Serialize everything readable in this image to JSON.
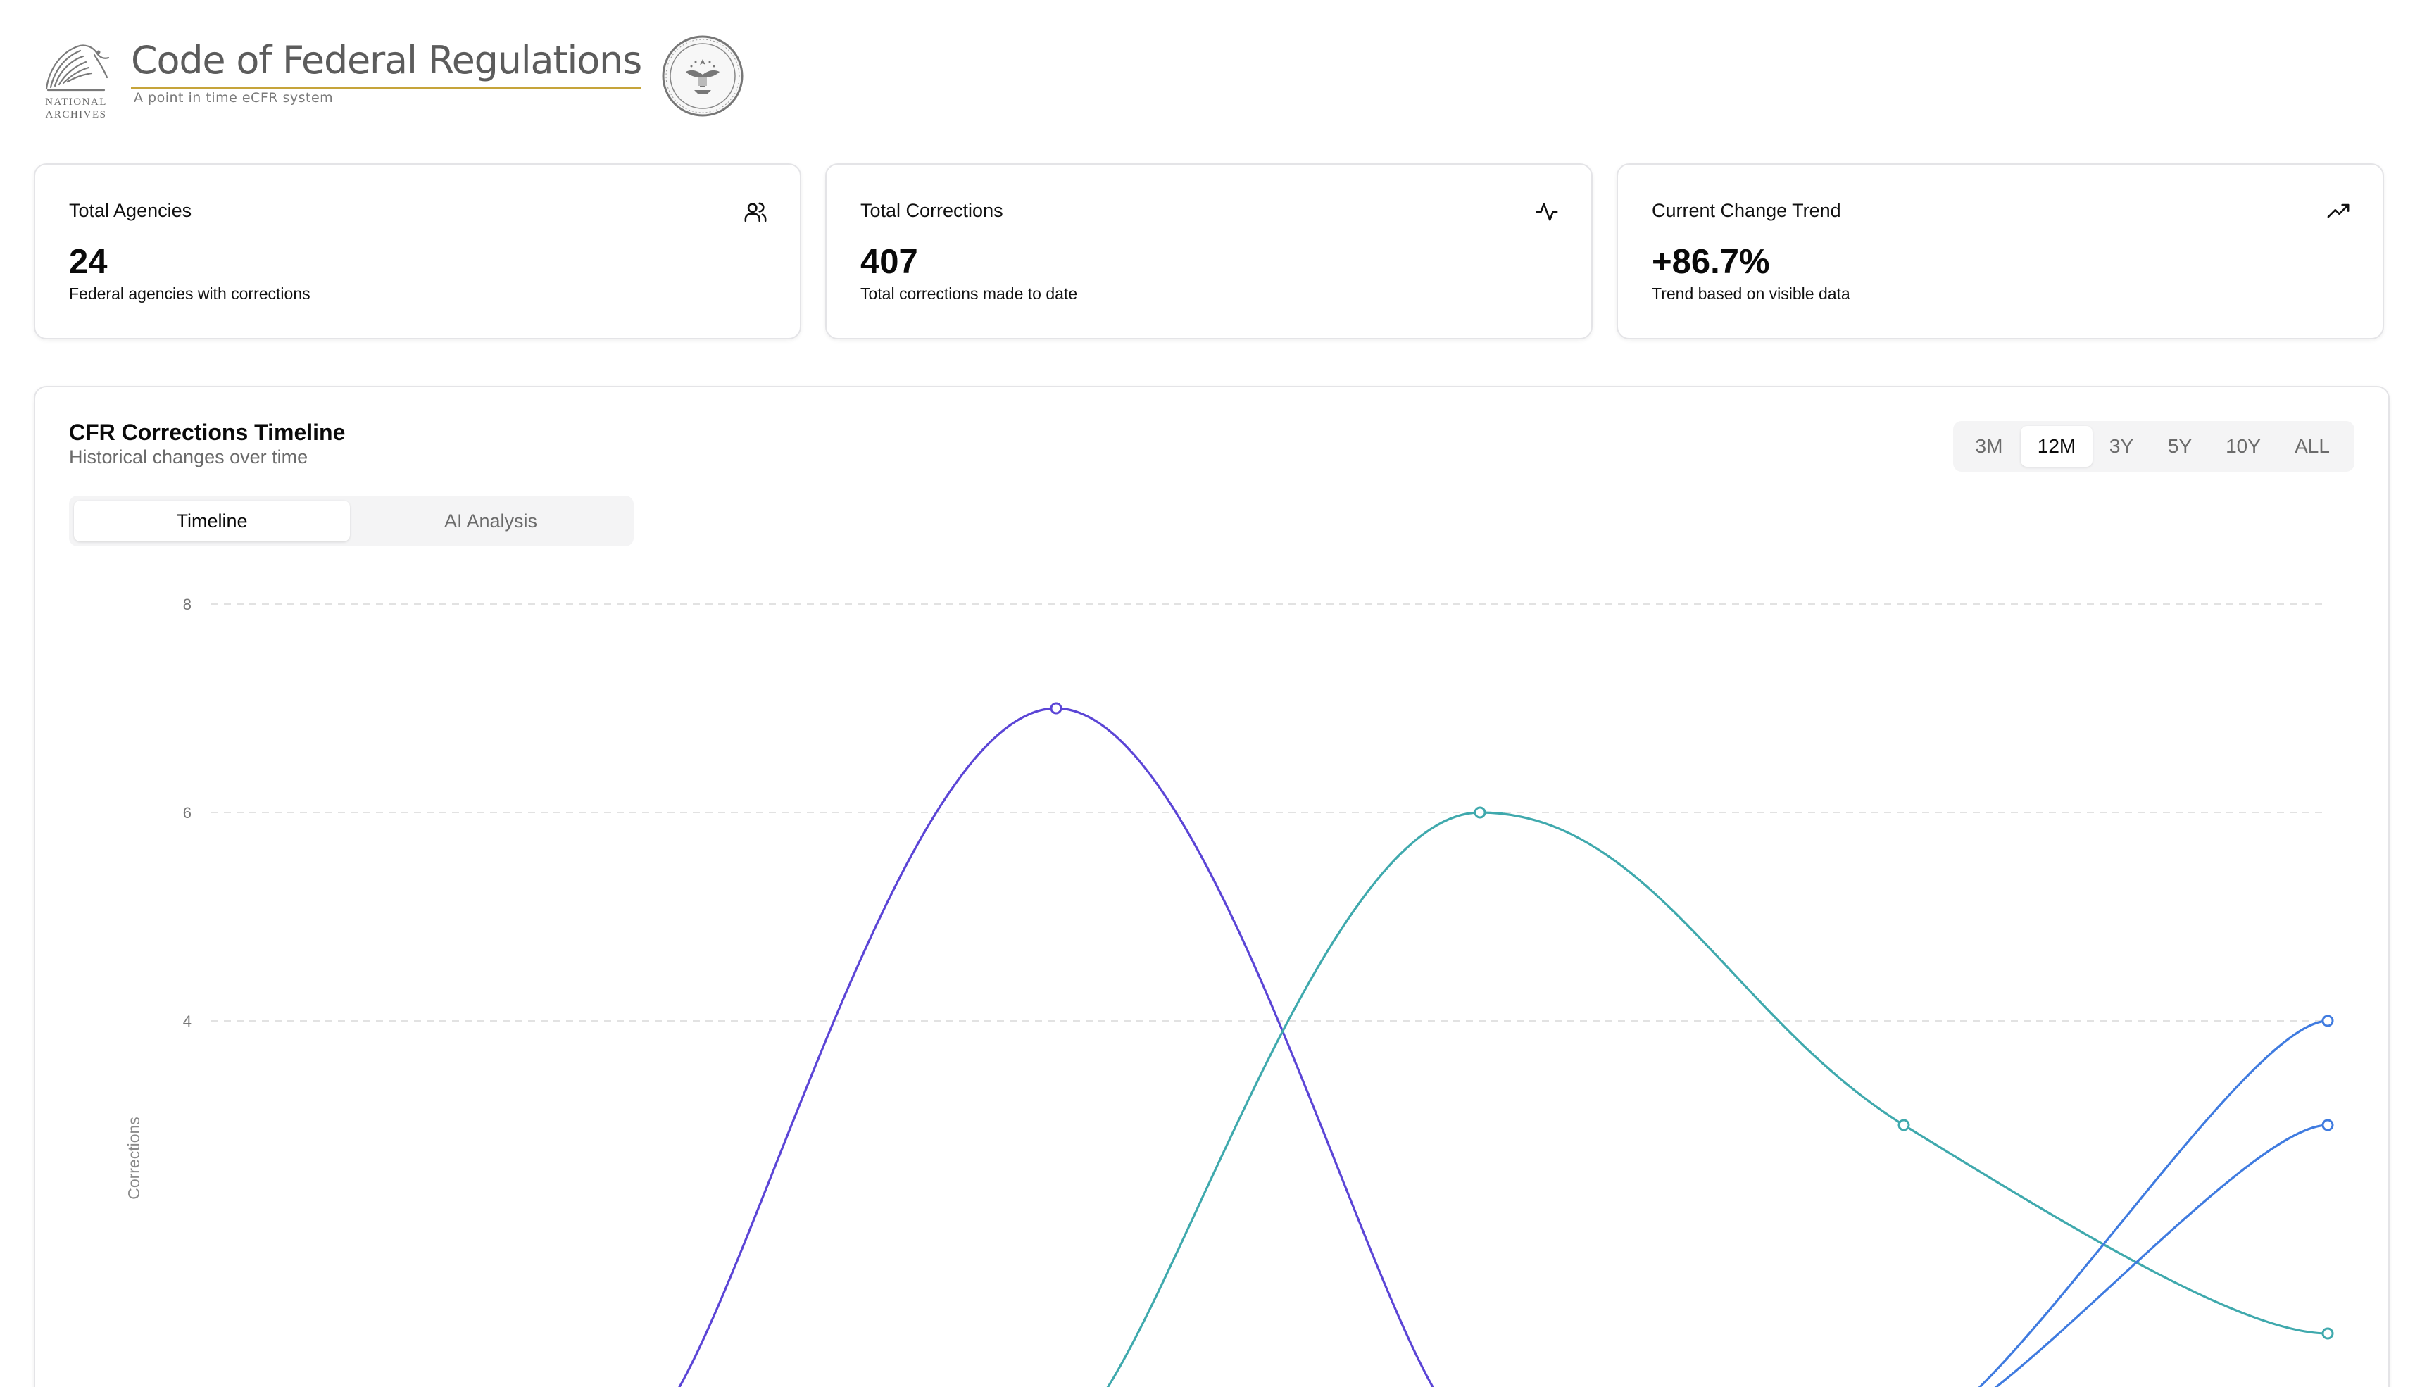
{
  "header": {
    "logo_text": "NATIONAL ARCHIVES",
    "title": "Code of Federal Regulations",
    "tagline": "A point in time eCFR system",
    "seal_icon": "archives-seal-icon",
    "accent_color": "#c6a43a"
  },
  "stats": [
    {
      "label": "Total Agencies",
      "value": "24",
      "description": "Federal agencies with corrections",
      "icon": "users-icon"
    },
    {
      "label": "Total Corrections",
      "value": "407",
      "description": "Total corrections made to date",
      "icon": "activity-icon"
    },
    {
      "label": "Current Change Trend",
      "value": "+86.7%",
      "description": "Trend based on visible data",
      "icon": "trending-up-icon"
    }
  ],
  "timeline": {
    "title": "CFR Corrections Timeline",
    "subtitle": "Historical changes over time",
    "view_tabs": [
      {
        "label": "Timeline",
        "active": true
      },
      {
        "label": "AI Analysis",
        "active": false
      }
    ],
    "ranges": [
      {
        "label": "3M",
        "active": false
      },
      {
        "label": "12M",
        "active": true
      },
      {
        "label": "3Y",
        "active": false
      },
      {
        "label": "5Y",
        "active": false
      },
      {
        "label": "10Y",
        "active": false
      },
      {
        "label": "ALL",
        "active": false
      }
    ]
  },
  "chart_data": {
    "type": "line",
    "title": "",
    "xlabel": "",
    "ylabel": "Corrections",
    "ylim": [
      0,
      8
    ],
    "y_ticks_visible": [
      8,
      6,
      4
    ],
    "grid": "horizontal-dashed",
    "x": [
      0,
      1,
      2,
      3,
      4,
      5
    ],
    "series": [
      {
        "color": "#5b45d6",
        "values": [
          null,
          0,
          7,
          0,
          null,
          null
        ]
      },
      {
        "color": "#3fa9ad",
        "values": [
          null,
          null,
          0,
          6,
          3,
          1
        ]
      },
      {
        "color": "#3f7be0",
        "values": [
          null,
          null,
          null,
          null,
          0,
          4
        ]
      },
      {
        "color": "#3f7be0",
        "values": [
          null,
          null,
          null,
          null,
          0,
          3
        ]
      }
    ]
  }
}
